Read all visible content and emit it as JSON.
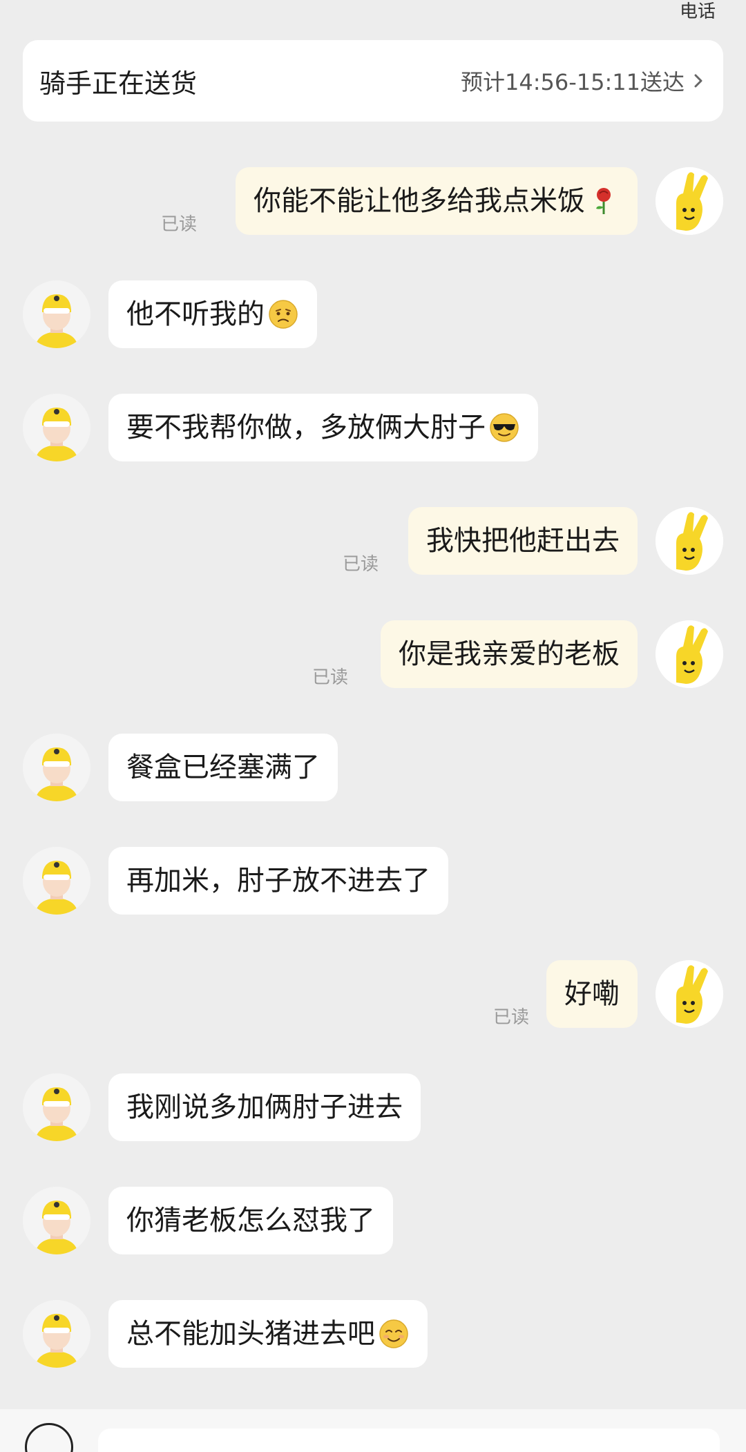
{
  "header": {
    "phone_link": "电话"
  },
  "status_card": {
    "title": "骑手正在送货",
    "eta": "预计14:56-15:11送达"
  },
  "read_label": "已读",
  "messages": [
    {
      "from": "me",
      "text": "你能不能让他多给我点米饭",
      "emoji": "rose-icon",
      "read": true
    },
    {
      "from": "rider",
      "text": "他不听我的",
      "emoji": "worried-face-icon"
    },
    {
      "from": "rider",
      "text": "要不我帮你做，多放俩大肘子",
      "emoji": "sunglasses-face-icon"
    },
    {
      "from": "me",
      "text": "我快把他赶出去",
      "read": true
    },
    {
      "from": "me",
      "text": "你是我亲爱的老板",
      "read": true
    },
    {
      "from": "rider",
      "text": "餐盒已经塞满了"
    },
    {
      "from": "rider",
      "text": "再加米，肘子放不进去了"
    },
    {
      "from": "me",
      "text": "好嘞",
      "read": true
    },
    {
      "from": "rider",
      "text": "我刚说多加俩肘子进去"
    },
    {
      "from": "rider",
      "text": "你猜老板怎么怼我了"
    },
    {
      "from": "rider",
      "text": "总不能加头猪进去吧",
      "emoji": "smiling-face-icon"
    }
  ],
  "colors": {
    "background": "#ededed",
    "bubble_in": "#ffffff",
    "bubble_out": "#fdf8e6",
    "brand_yellow": "#f7d628"
  }
}
